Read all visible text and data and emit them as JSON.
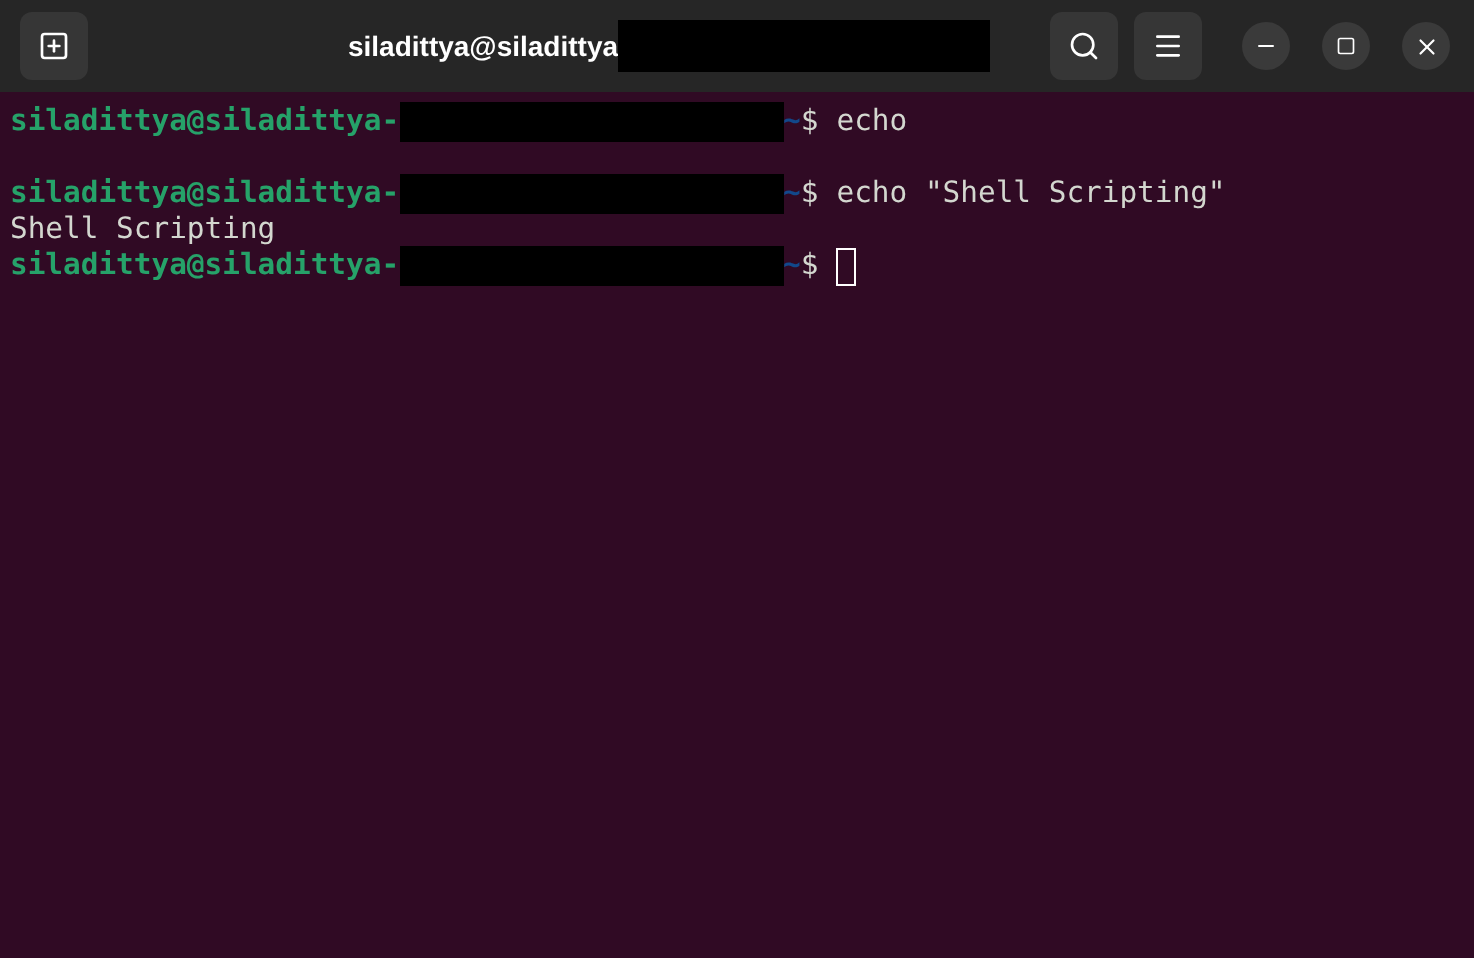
{
  "window": {
    "title": "siladittya@siladittya",
    "title_redacted": true
  },
  "lines": [
    {
      "kind": "prompt",
      "user": "siladittya@siladittya-",
      "redacted": true,
      "path": "~",
      "symbol": "$",
      "command": "echo",
      "cursor": false
    },
    {
      "kind": "blank"
    },
    {
      "kind": "prompt",
      "user": "siladittya@siladittya-",
      "redacted": true,
      "path": "~",
      "symbol": "$",
      "command": "echo \"Shell Scripting\"",
      "cursor": false
    },
    {
      "kind": "output",
      "text": "Shell Scripting"
    },
    {
      "kind": "prompt",
      "user": "siladittya@siladittya-",
      "redacted": true,
      "path": "~",
      "symbol": "$",
      "cursor": true
    }
  ]
}
